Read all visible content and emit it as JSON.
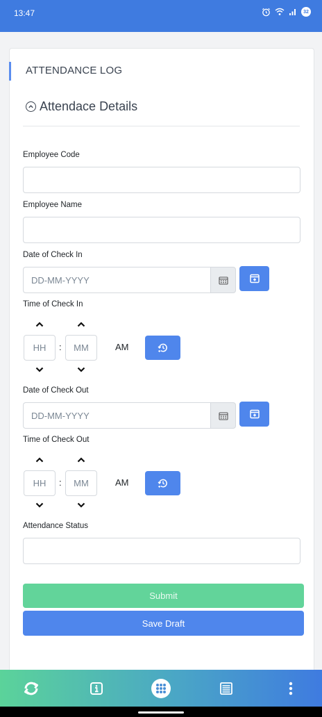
{
  "status": {
    "time": "13:47",
    "battery": "32"
  },
  "card": {
    "title": "ATTENDANCE LOG"
  },
  "section": {
    "title": "Attendace Details"
  },
  "fields": {
    "employee_code": {
      "label": "Employee Code",
      "value": ""
    },
    "employee_name": {
      "label": "Employee Name",
      "value": ""
    },
    "checkin_date": {
      "label": "Date of Check In",
      "placeholder": "DD-MM-YYYY"
    },
    "checkin_time": {
      "label": "Time of Check In",
      "hour_placeholder": "HH",
      "minute_placeholder": "MM",
      "separator": ":",
      "meridian": "AM"
    },
    "checkout_date": {
      "label": "Date of Check Out",
      "placeholder": "DD-MM-YYYY"
    },
    "checkout_time": {
      "label": "Time of Check Out",
      "hour_placeholder": "HH",
      "minute_placeholder": "MM",
      "separator": ":",
      "meridian": "AM"
    },
    "attendance_status": {
      "label": "Attendance Status",
      "value": ""
    }
  },
  "actions": {
    "submit": "Submit",
    "save_draft": "Save Draft"
  },
  "bottom_nav": [
    {
      "icon": "sync-icon"
    },
    {
      "icon": "info-icon"
    },
    {
      "icon": "apps-grid-icon"
    },
    {
      "icon": "list-icon"
    },
    {
      "icon": "more-vertical-icon"
    }
  ],
  "colors": {
    "header": "#3f7be0",
    "primary": "#4f86ec",
    "success": "#62d49a"
  }
}
